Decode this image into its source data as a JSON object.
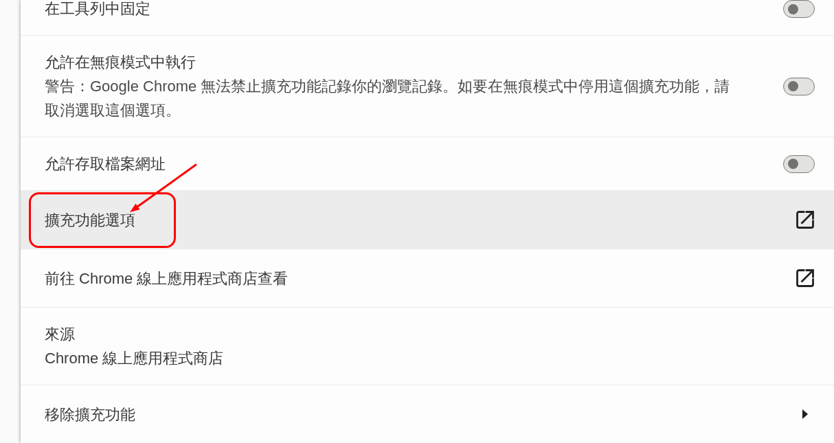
{
  "rows": [
    {
      "kind": "toggle",
      "label": "在工具列中固定",
      "on": false,
      "hovered": false,
      "annotated": false
    },
    {
      "kind": "toggle",
      "label": "允許在無痕模式中執行",
      "description": "警告：Google Chrome 無法禁止擴充功能記錄你的瀏覽記錄。如要在無痕模式中停用這個擴充功能，請取消選取這個選項。",
      "on": false,
      "hovered": false,
      "annotated": false
    },
    {
      "kind": "toggle",
      "label": "允許存取檔案網址",
      "on": false,
      "hovered": false,
      "annotated": false
    },
    {
      "kind": "external_link",
      "label": "擴充功能選項",
      "hovered": true,
      "annotated": true
    },
    {
      "kind": "external_link",
      "label": "前往 Chrome 線上應用程式商店查看",
      "hovered": false,
      "annotated": false
    },
    {
      "kind": "info",
      "label": "來源",
      "value": "Chrome 線上應用程式商店",
      "hovered": false,
      "annotated": false
    },
    {
      "kind": "submenu",
      "label": "移除擴充功能",
      "hovered": false,
      "annotated": false
    }
  ]
}
